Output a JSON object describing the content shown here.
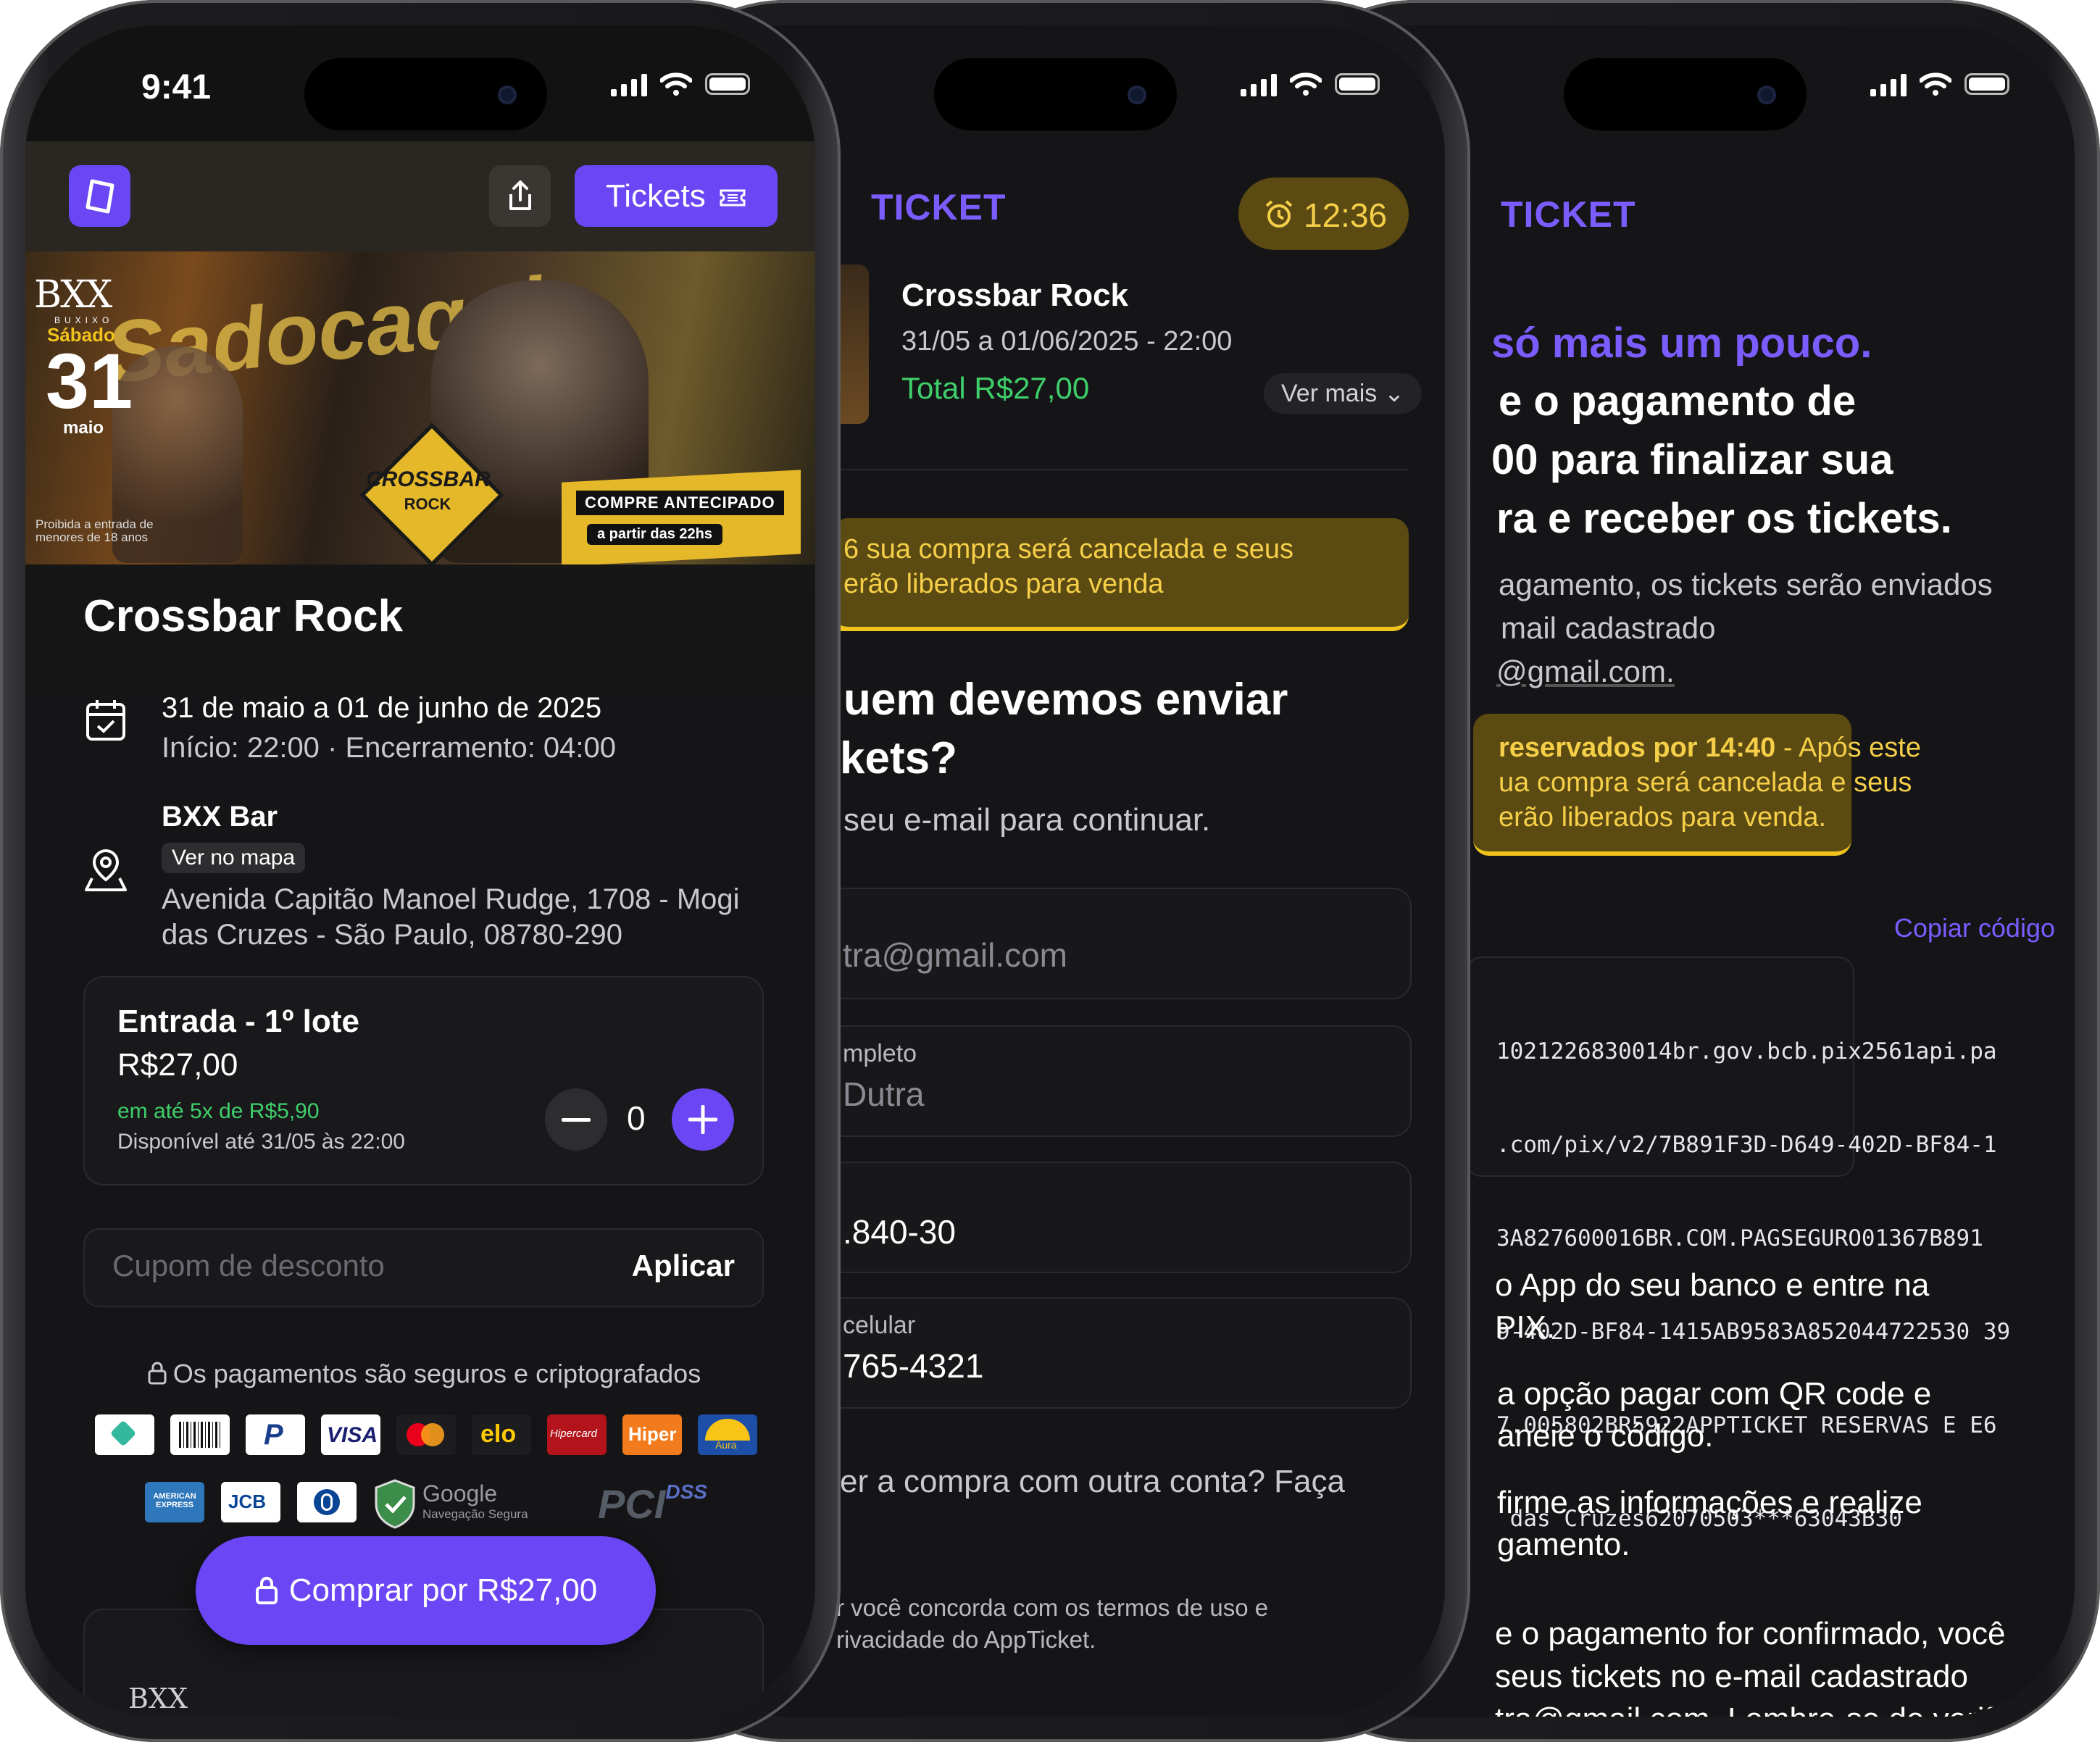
{
  "status": {
    "time": "9:41"
  },
  "screen1": {
    "tickets_button": "Tickets",
    "banner": {
      "brand": "BXX",
      "brand_sub": "BUXIXO",
      "weekday": "Sábado",
      "day": "31",
      "month": "maio",
      "script_text": "Sadocaqui",
      "badge_line1": "CROSSBAR",
      "badge_line2": "ROCK",
      "advance": "COMPRE ANTECIPADO",
      "from": "a partir das 22hs",
      "notice": "Proibida a entrada de menores de 18 anos"
    },
    "event_title": "Crossbar Rock",
    "date_line": "31 de maio a 01 de junho de 2025",
    "time_line": "Início: 22:00 · Encerramento: 04:00",
    "venue": "BXX Bar",
    "map_button": "Ver no mapa",
    "address": "Avenida Capitão Manoel Rudge, 1708 - Mogi das Cruzes - São Paulo, 08780-290",
    "ticket": {
      "name": "Entrada - 1º lote",
      "price": "R$27,00",
      "installments": "em até 5x de R$5,90",
      "available": "Disponível até 31/05 às 22:00",
      "quantity": "0"
    },
    "coupon_placeholder": "Cupom de desconto",
    "apply": "Aplicar",
    "secure_text": "Os pagamentos são seguros e criptografados",
    "payment_logos": [
      "PIX",
      "Boleto",
      "PayPal",
      "VISA",
      "Mastercard",
      "elo",
      "Hipercard",
      "Hiper",
      "Aura",
      "American Express",
      "JCB",
      "Diners",
      "Google Navegação Segura",
      "PCI DSS"
    ],
    "logo_texts": {
      "visa": "VISA",
      "elo": "elo",
      "hipercard": "Hipercard",
      "hiper": "Hiper",
      "aura": "Aura",
      "amex": "AMERICAN EXPRESS",
      "jcb": "JCB",
      "google": "Google",
      "google_sub": "Navegação Segura",
      "pci": "PCI",
      "dss": "DSS"
    },
    "buy_button": "Comprar por R$27,00",
    "footer_brand": "BXX"
  },
  "screen2": {
    "brand": "TICKET",
    "timer": "12:36",
    "event_title": "Crossbar Rock",
    "dates": "31/05 a 01/06/2025 - 22:00",
    "total": "Total R$27,00",
    "ver_mais": "Ver mais",
    "warning_line1": "6 sua compra será cancelada e seus",
    "warning_line2": "erão liberados para venda",
    "heading_line1": "uem devemos enviar",
    "heading_line2": "kets?",
    "subtitle": "seu e-mail para continuar.",
    "email_value": "tra@gmail.com",
    "name_label": "mpleto",
    "name_value": "Dutra",
    "cpf_value": ".840-30",
    "phone_label": "celular",
    "phone_value": "765-4321",
    "other_account": "er a compra com outra conta? Faça",
    "terms_line1": "r você concorda com os termos de uso e",
    "terms_line2": "rivacidade do AppTicket."
  },
  "screen3": {
    "brand": "TICKET",
    "title_line1": "só mais um pouco.",
    "title_line2": "e o pagamento de",
    "title_line3": "00 para finalizar sua",
    "title_line4": "ra e receber os tickets.",
    "desc_line1": "agamento, os tickets serão enviados",
    "desc_line2": "mail cadastrado",
    "desc_line3": "@gmail.com.",
    "warn_strong": "reservados por 14:40",
    "warn_line1_rest": " - Após este",
    "warn_line2": "ua compra será cancelada e seus",
    "warn_line3": "erão liberados para venda.",
    "copy_code": "Copiar código",
    "pix_code": [
      "1021226830014br.gov.bcb.pix2561api.pa",
      ".com/pix/v2/7B891F3D-D649-402D-BF84-1",
      "3A827600016BR.COM.PAGSEGURO01367B891",
      "9-402D-BF84-1415AB9583A852044722530 39",
      "7.005802BR5922APPTICKET RESERVAS E E6",
      " das Cruzes62070503***63043B30"
    ],
    "step1_line1": "o App do seu banco e entre na",
    "step1_line2": "PIX.",
    "step2_line1": "a opção pagar com QR code e",
    "step2_line2": "aneie o código.",
    "step3_line1": "firme as informações e realize",
    "step3_line2": "gamento.",
    "final_line1": "e o pagamento for confirmado, você",
    "final_line2": "seus tickets no e-mail cadastrado",
    "final_line3": "tra@gmail.com. Lembre-se de verificar"
  },
  "colors": {
    "accent": "#6b46f5",
    "yellow": "#f0c21c",
    "green": "#3fcf6a",
    "background": "#151517"
  }
}
